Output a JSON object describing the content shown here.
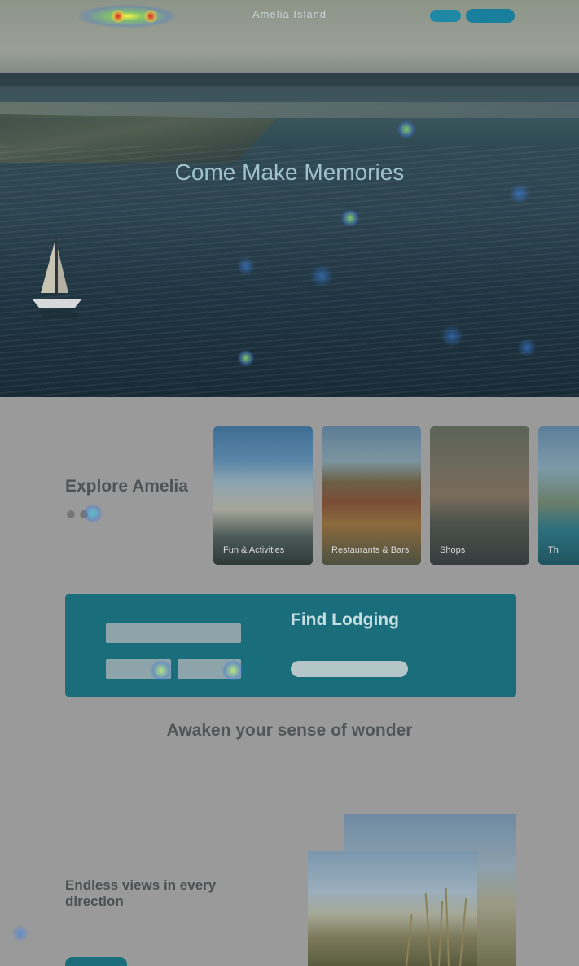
{
  "nav": {
    "logo": "Amelia Island",
    "link_label": "",
    "button1_label": "",
    "button2_label": ""
  },
  "hero": {
    "title": "Come Make Memories",
    "subtitle": ""
  },
  "explore": {
    "title": "Explore Amelia",
    "cards": [
      {
        "label": "Fun & Activities"
      },
      {
        "label": "Restaurants & Bars"
      },
      {
        "label": "Shops"
      },
      {
        "label": "Th"
      }
    ]
  },
  "lodging": {
    "title": "Find Lodging",
    "type_label": "",
    "type_value": "",
    "checkin_label": "",
    "checkin_value": "",
    "checkout_label": "",
    "checkout_value": "",
    "description": "",
    "cta_label": ""
  },
  "awaken": {
    "title": "Awaken your sense of wonder",
    "subtitle": ""
  },
  "endless": {
    "eyebrow": "",
    "title": "Endless views in every direction",
    "body": "",
    "button_label": ""
  },
  "colors": {
    "teal": "#1a6e7c",
    "overlay_gray": "#9a9a9a"
  }
}
